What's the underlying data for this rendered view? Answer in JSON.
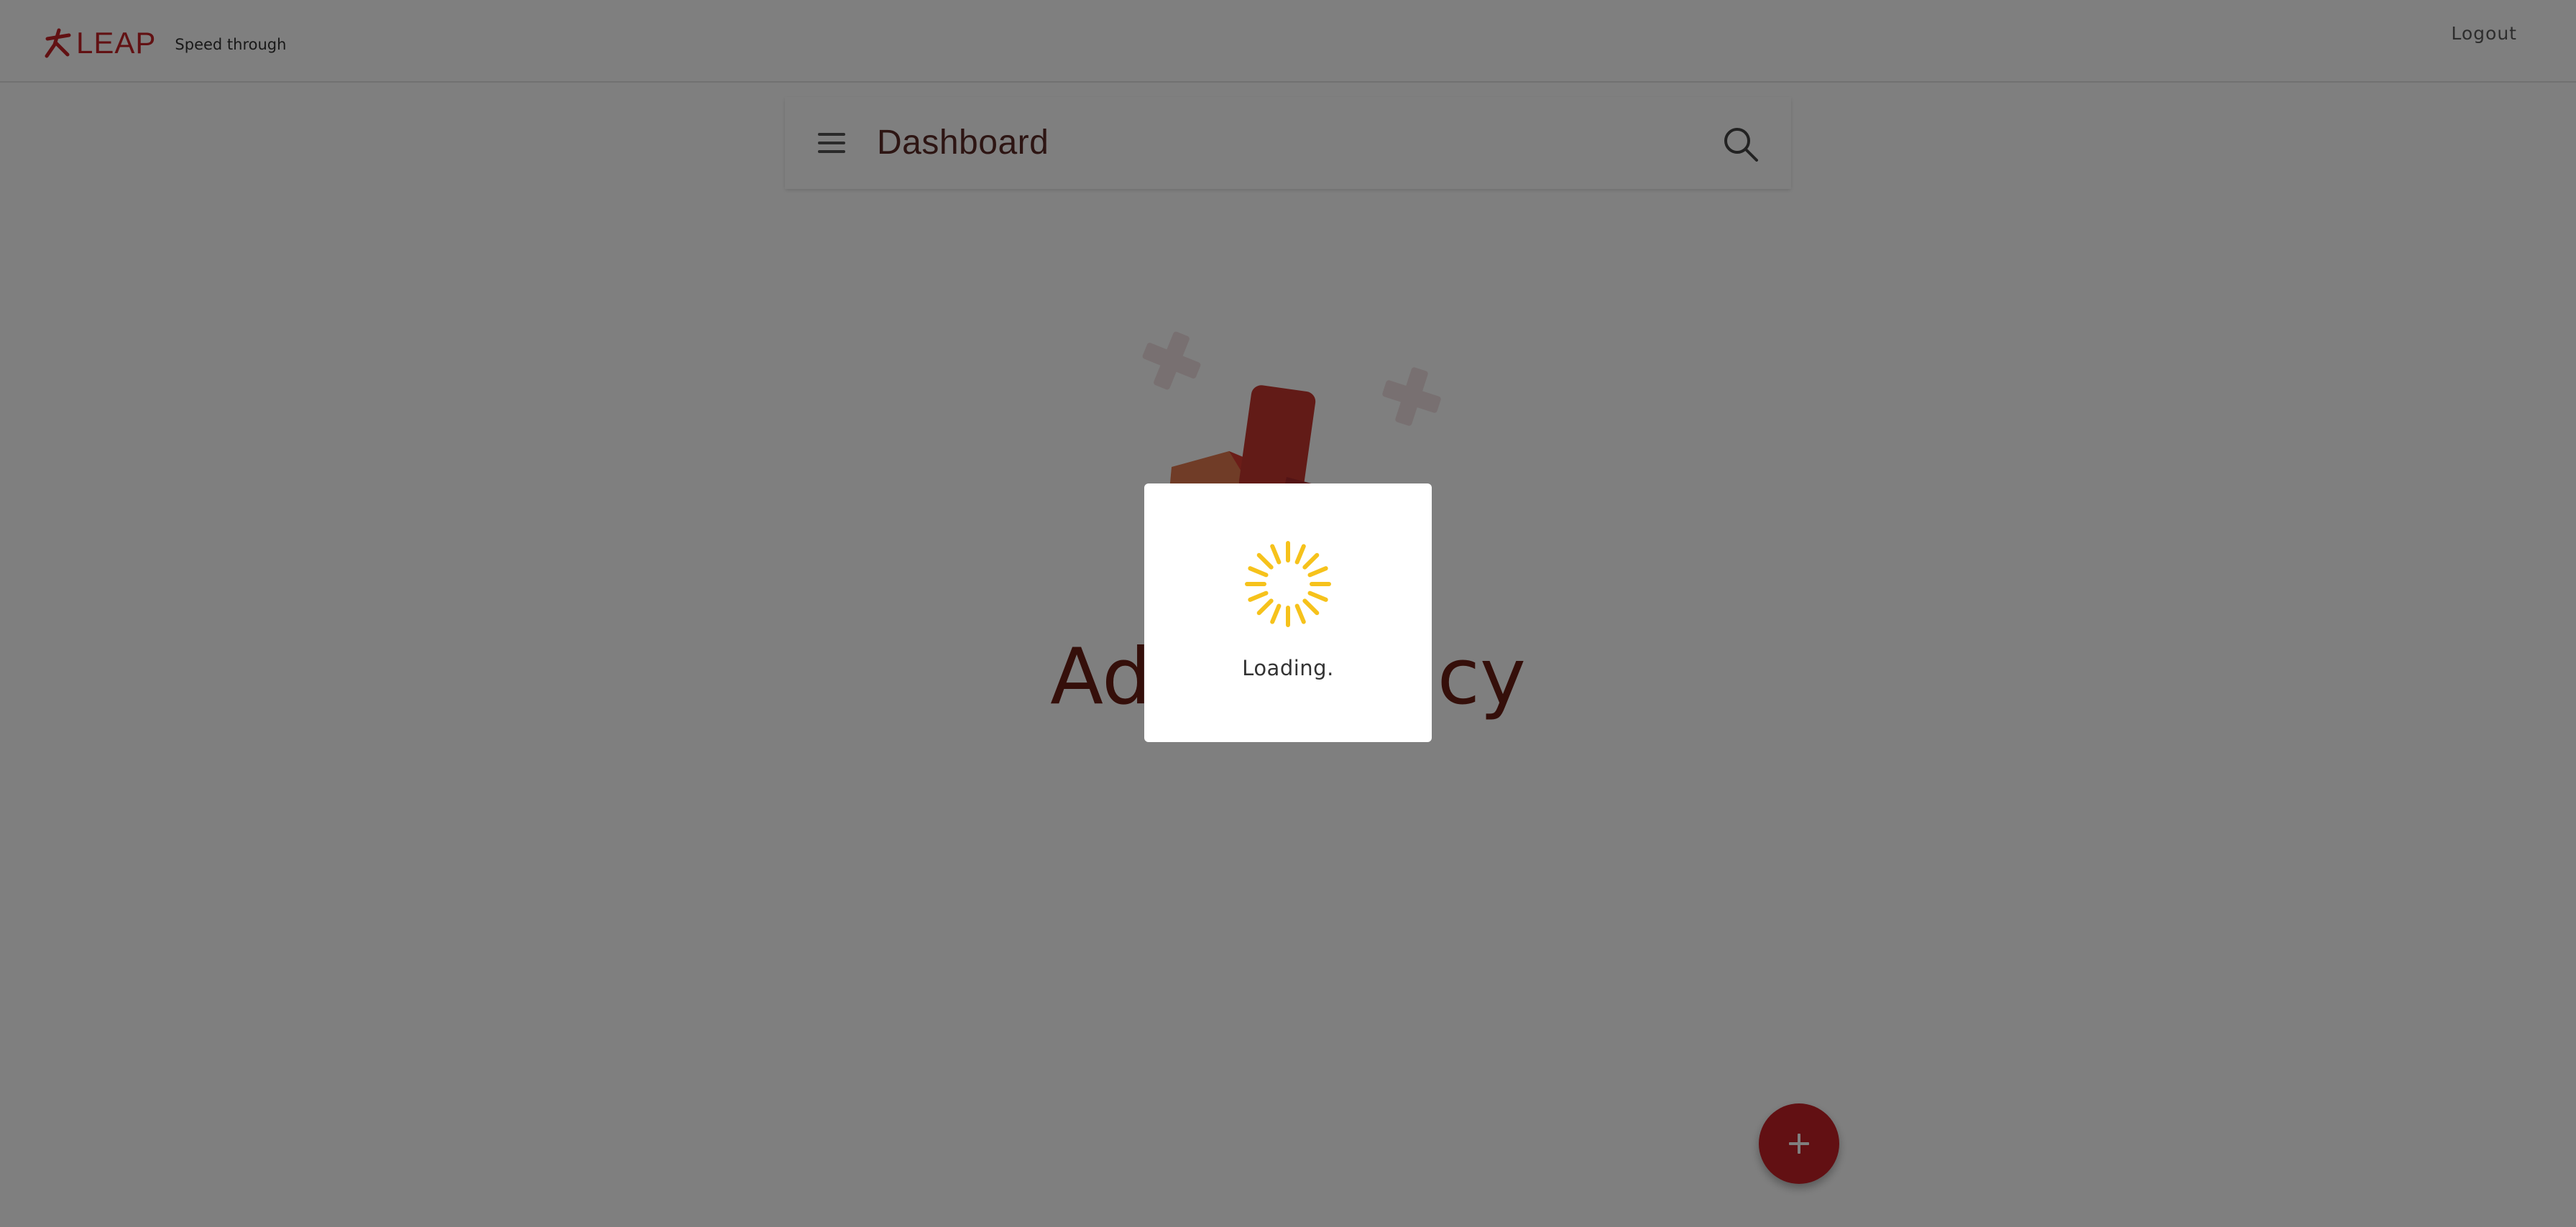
{
  "header": {
    "brand_name": "LEAP",
    "tagline": "Speed through",
    "logout_label": "Logout",
    "brand_color": "#c42226"
  },
  "appbar": {
    "title": "Dashboard",
    "menu_icon": "hamburger-menu-icon",
    "search_icon": "search-icon"
  },
  "main": {
    "empty_state_title": "Add a policy",
    "illustration": "first-aid-kit-illustration"
  },
  "fab": {
    "icon": "plus-icon",
    "color": "#c52026"
  },
  "loading_dialog": {
    "text": "Loading.",
    "spinner_color": "#f6c21b"
  },
  "overlay": {
    "color": "rgba(0,0,0,0.5)"
  }
}
